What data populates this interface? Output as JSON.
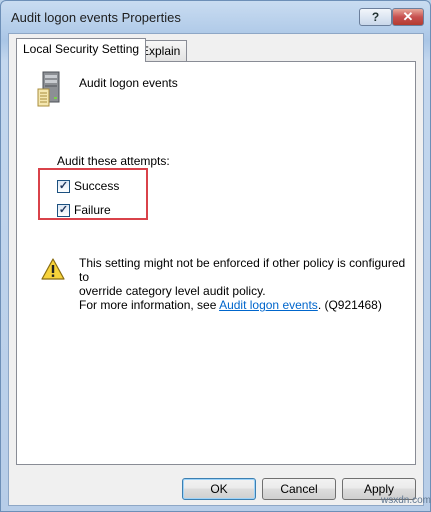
{
  "window": {
    "title": "Audit logon events Properties",
    "help_label": "?",
    "close_label": "✕"
  },
  "tabs": [
    {
      "label": "Local Security Setting",
      "active": true
    },
    {
      "label": "Explain",
      "active": false
    }
  ],
  "policy": {
    "name": "Audit logon events",
    "icon": "server-icon"
  },
  "audit": {
    "label": "Audit these attempts:",
    "success": {
      "label": "Success",
      "checked": true,
      "mark": "✓"
    },
    "failure": {
      "label": "Failure",
      "checked": true,
      "mark": "✓"
    },
    "highlight_color": "#d9424a"
  },
  "warning": {
    "icon": "warning-icon",
    "line1": "This setting might not be enforced if other policy is configured to",
    "line2": "override category level audit policy.",
    "line3_prefix": "For more information, see ",
    "link_text": "Audit logon events",
    "line3_suffix": ". (Q921468)"
  },
  "buttons": {
    "ok": "OK",
    "cancel": "Cancel",
    "apply": "Apply"
  },
  "watermark": "wsxdn.com",
  "colors": {
    "link": "#0066cc",
    "close_button": "#c75050",
    "window_frame": "#aac6e6"
  }
}
